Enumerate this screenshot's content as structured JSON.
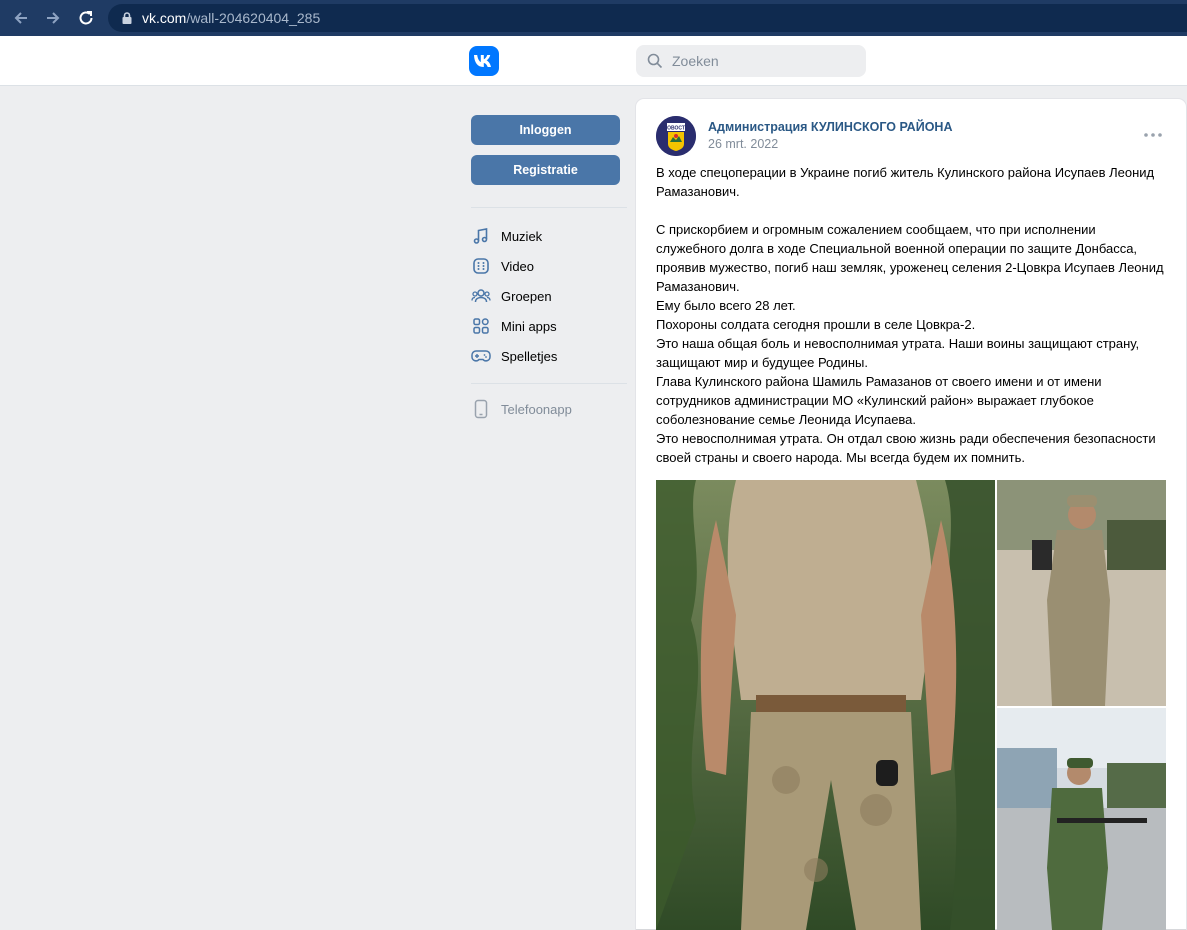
{
  "browser": {
    "url_domain": "vk.com",
    "url_path": "/wall-204620404_285"
  },
  "header": {
    "search_placeholder": "Zoeken"
  },
  "sidebar": {
    "login_label": "Inloggen",
    "register_label": "Registratie",
    "menu": [
      {
        "label": "Muziek",
        "icon": "music-icon"
      },
      {
        "label": "Video",
        "icon": "video-icon"
      },
      {
        "label": "Groepen",
        "icon": "groups-icon"
      },
      {
        "label": "Mini apps",
        "icon": "mini-apps-icon"
      },
      {
        "label": "Spelletjes",
        "icon": "games-icon"
      }
    ],
    "phone_app_label": "Telefoonapp"
  },
  "post": {
    "author": "Администрация КУЛИНСКОГО РАЙОНА",
    "avatar_text": "НОВОСТИ",
    "date": "26 mrt. 2022",
    "paragraphs": [
      "В ходе спецоперации в Украине погиб житель Кулинского района Исупаев Леонид Рамазанович.",
      "",
      "С прискорбием и огромным сожалением сообщаем, что при исполнении служебного долга в ходе Специальной военной операции по защите Донбасса, проявив мужество, погиб наш земляк, уроженец селения 2-Цовкра Исупаев Леонид Рамазанович.",
      "Ему было всего 28 лет.",
      "Похороны солдата сегодня прошли в селе Цовкра-2.",
      "Это наша общая боль и невосполнимая утрата. Наши воины защищают страну, защищают мир и будущее Родины.",
      "Глава Кулинского района Шамиль Рамазанов от своего имени и от имени сотрудников администрации МО «Кулинский район» выражает глубокое соболезнование семье Леонида Исупаева.",
      "Это невосполнимая утрата. Он отдал свою жизнь ради обеспечения безопасности своей страны и своего народа. Мы всегда будем их помнить."
    ]
  }
}
